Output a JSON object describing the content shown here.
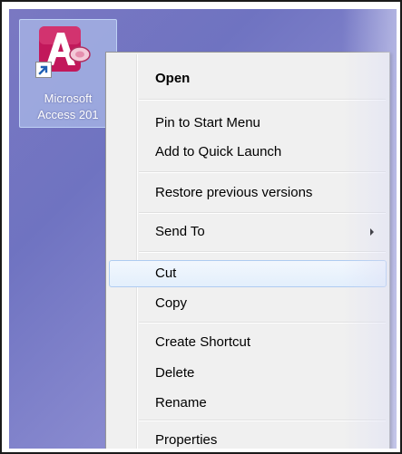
{
  "desktop": {
    "shortcut": {
      "label_line1": "Microsoft",
      "label_line2": "Access 201",
      "icon": "microsoft-access-icon",
      "overlay_icon": "shortcut-arrow-icon"
    }
  },
  "context_menu": {
    "items": [
      {
        "label": "Open",
        "bold": true
      },
      {
        "label": "Pin to Start Menu"
      },
      {
        "label": "Add to Quick Launch"
      },
      {
        "label": "Restore previous versions"
      },
      {
        "label": "Send To",
        "submenu": true
      },
      {
        "label": "Cut",
        "highlighted": true
      },
      {
        "label": "Copy"
      },
      {
        "label": "Create Shortcut"
      },
      {
        "label": "Delete"
      },
      {
        "label": "Rename"
      },
      {
        "label": "Properties"
      }
    ]
  },
  "colors": {
    "desktop": "#7a78c2",
    "menu_background": "#f0f0f0",
    "hover_border": "#aeccf1",
    "access_red": "#c2185b"
  }
}
